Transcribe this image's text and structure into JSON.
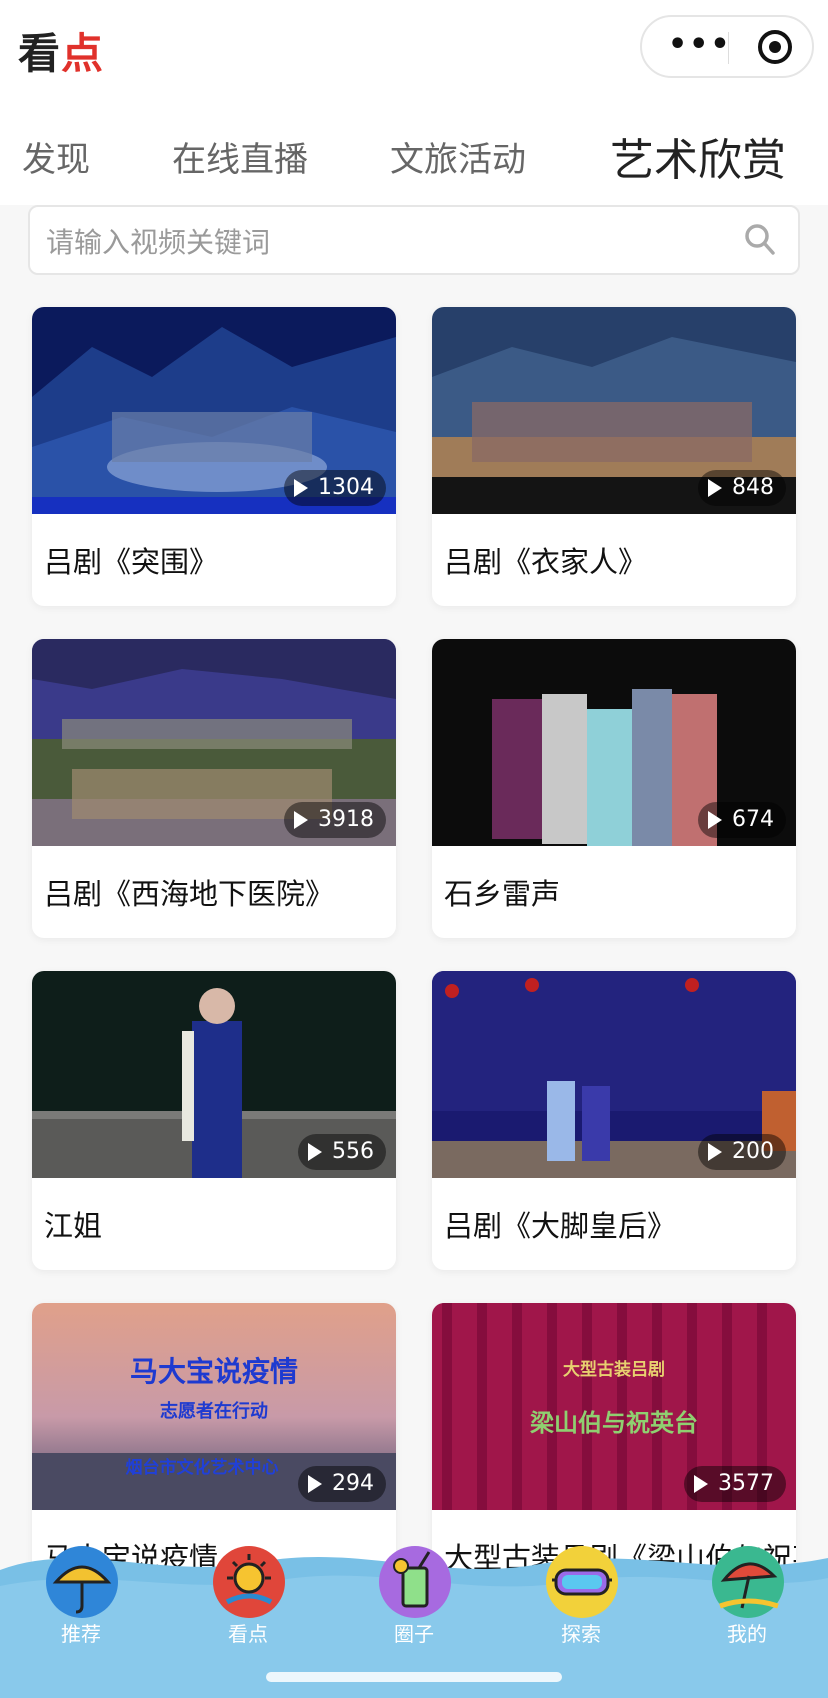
{
  "header": {
    "logo_left": "看",
    "logo_right": "点",
    "menu_icon": "more-dots-icon",
    "close_icon": "target-icon"
  },
  "tabs": [
    {
      "label": "发现",
      "active": false
    },
    {
      "label": "在线直播",
      "active": false
    },
    {
      "label": "文旅活动",
      "active": false
    },
    {
      "label": "艺术欣赏",
      "active": true
    }
  ],
  "search": {
    "placeholder": "请输入视频关键词",
    "icon": "search-icon"
  },
  "videos": [
    {
      "title": "吕剧《突围》",
      "views": "1304"
    },
    {
      "title": "吕剧《衣家人》",
      "views": "848"
    },
    {
      "title": "吕剧《西海地下医院》",
      "views": "3918"
    },
    {
      "title": "石乡雷声",
      "views": "674"
    },
    {
      "title": "江姐",
      "views": "556"
    },
    {
      "title": "吕剧《大脚皇后》",
      "views": "200"
    },
    {
      "title": "马大宝说疫情",
      "views": "294",
      "thumb_text": [
        "马大宝说疫情",
        "志愿者在行动",
        "烟台市文化艺术中心"
      ]
    },
    {
      "title": "大型古装吕剧《梁山伯与祝英台》",
      "views": "3577",
      "thumb_text": [
        "大型古装吕剧",
        "梁山伯与祝英台"
      ]
    }
  ],
  "tabbar": [
    {
      "label": "推荐",
      "icon": "umbrella-icon"
    },
    {
      "label": "看点",
      "icon": "sun-icon"
    },
    {
      "label": "圈子",
      "icon": "drink-icon"
    },
    {
      "label": "探索",
      "icon": "goggles-icon"
    },
    {
      "label": "我的",
      "icon": "beach-umbrella-icon"
    }
  ],
  "colors": {
    "accent": "#e0312b",
    "tabbar_water": "#7cc3e6",
    "text": "#111111"
  }
}
